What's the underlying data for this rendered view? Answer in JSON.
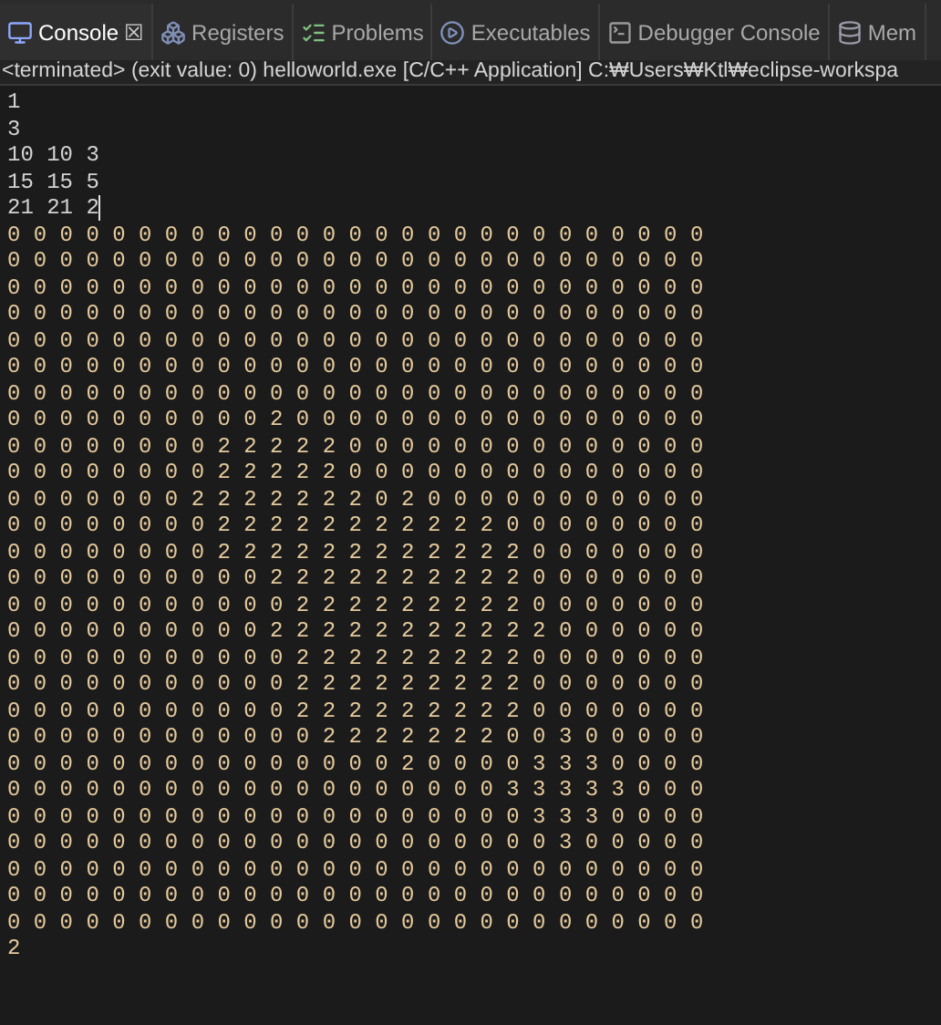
{
  "tabs": [
    {
      "label": "Console",
      "selected": true,
      "closable": true
    },
    {
      "label": "Registers",
      "selected": false,
      "closable": false
    },
    {
      "label": "Problems",
      "selected": false,
      "closable": false
    },
    {
      "label": "Executables",
      "selected": false,
      "closable": false
    },
    {
      "label": "Debugger Console",
      "selected": false,
      "closable": false
    },
    {
      "label": "Mem",
      "selected": false,
      "closable": false
    }
  ],
  "close_glyph": "☒",
  "status_line": "<terminated> (exit value: 0) helloworld.exe [C/C++ Application] C:₩Users₩Ktl₩eclipse-workspa",
  "input_lines": [
    "1",
    "3",
    "10 10 3",
    "15 15 5",
    "21 21 2"
  ],
  "output_lines": [
    "0 0 0 0 0 0 0 0 0 0 0 0 0 0 0 0 0 0 0 0 0 0 0 0 0 0 0",
    "0 0 0 0 0 0 0 0 0 0 0 0 0 0 0 0 0 0 0 0 0 0 0 0 0 0 0",
    "0 0 0 0 0 0 0 0 0 0 0 0 0 0 0 0 0 0 0 0 0 0 0 0 0 0 0",
    "0 0 0 0 0 0 0 0 0 0 0 0 0 0 0 0 0 0 0 0 0 0 0 0 0 0 0",
    "0 0 0 0 0 0 0 0 0 0 0 0 0 0 0 0 0 0 0 0 0 0 0 0 0 0 0",
    "0 0 0 0 0 0 0 0 0 0 0 0 0 0 0 0 0 0 0 0 0 0 0 0 0 0 0",
    "0 0 0 0 0 0 0 0 0 0 0 0 0 0 0 0 0 0 0 0 0 0 0 0 0 0 0",
    "0 0 0 0 0 0 0 0 0 0 2 0 0 0 0 0 0 0 0 0 0 0 0 0 0 0 0",
    "0 0 0 0 0 0 0 0 2 2 2 2 2 0 0 0 0 0 0 0 0 0 0 0 0 0 0",
    "0 0 0 0 0 0 0 0 2 2 2 2 2 0 0 0 0 0 0 0 0 0 0 0 0 0 0",
    "0 0 0 0 0 0 0 2 2 2 2 2 2 2 0 2 0 0 0 0 0 0 0 0 0 0 0",
    "0 0 0 0 0 0 0 0 2 2 2 2 2 2 2 2 2 2 2 0 0 0 0 0 0 0 0",
    "0 0 0 0 0 0 0 0 2 2 2 2 2 2 2 2 2 2 2 2 0 0 0 0 0 0 0",
    "0 0 0 0 0 0 0 0 0 0 2 2 2 2 2 2 2 2 2 2 0 0 0 0 0 0 0",
    "0 0 0 0 0 0 0 0 0 0 0 2 2 2 2 2 2 2 2 2 0 0 0 0 0 0 0",
    "0 0 0 0 0 0 0 0 0 0 2 2 2 2 2 2 2 2 2 2 2 0 0 0 0 0 0",
    "0 0 0 0 0 0 0 0 0 0 0 2 2 2 2 2 2 2 2 2 0 0 0 0 0 0 0",
    "0 0 0 0 0 0 0 0 0 0 0 2 2 2 2 2 2 2 2 2 0 0 0 0 0 0 0",
    "0 0 0 0 0 0 0 0 0 0 0 2 2 2 2 2 2 2 2 2 0 0 0 0 0 0 0",
    "0 0 0 0 0 0 0 0 0 0 0 0 2 2 2 2 2 2 2 0 0 3 0 0 0 0 0",
    "0 0 0 0 0 0 0 0 0 0 0 0 0 0 0 2 0 0 0 0 3 3 3 0 0 0 0",
    "0 0 0 0 0 0 0 0 0 0 0 0 0 0 0 0 0 0 0 3 3 3 3 3 0 0 0",
    "0 0 0 0 0 0 0 0 0 0 0 0 0 0 0 0 0 0 0 0 3 3 3 0 0 0 0",
    "0 0 0 0 0 0 0 0 0 0 0 0 0 0 0 0 0 0 0 0 0 3 0 0 0 0 0",
    "0 0 0 0 0 0 0 0 0 0 0 0 0 0 0 0 0 0 0 0 0 0 0 0 0 0 0",
    "0 0 0 0 0 0 0 0 0 0 0 0 0 0 0 0 0 0 0 0 0 0 0 0 0 0 0",
    "0 0 0 0 0 0 0 0 0 0 0 0 0 0 0 0 0 0 0 0 0 0 0 0 0 0 0",
    "2"
  ]
}
